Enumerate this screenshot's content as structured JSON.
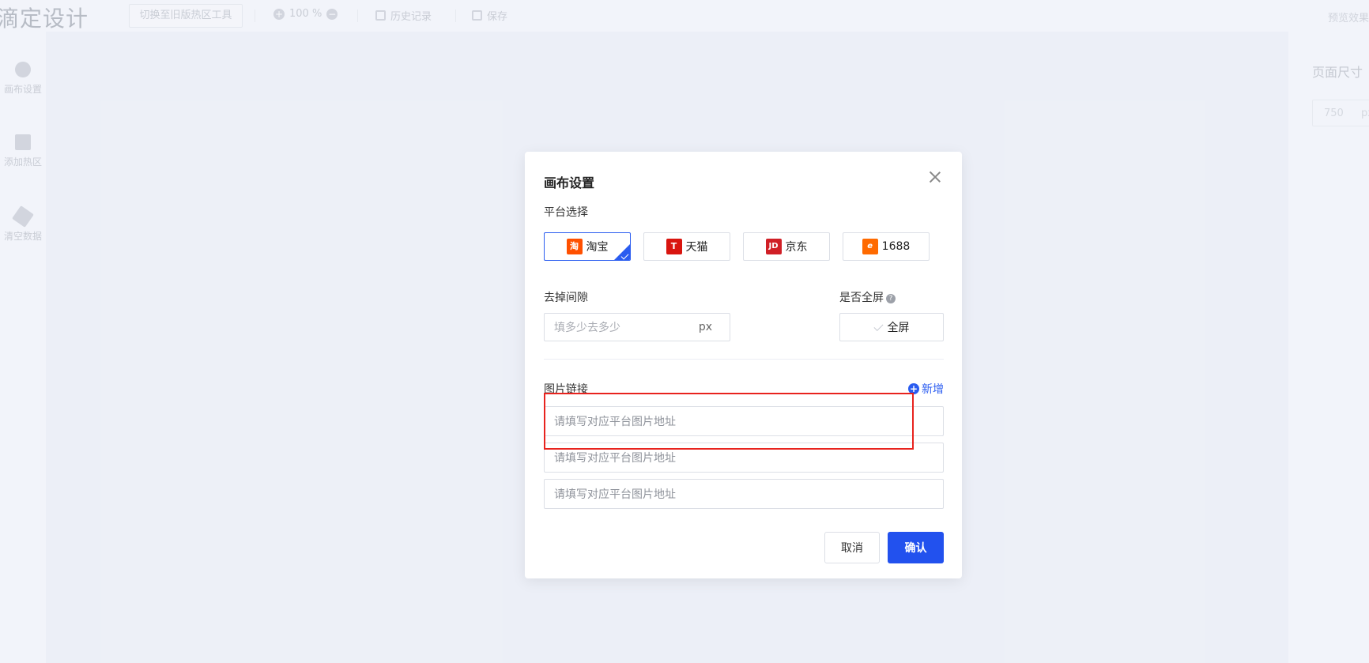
{
  "app": {
    "logo": "滴定设计",
    "switch_tool": "切换至旧版热区工具",
    "zoom": "100 %",
    "history": "历史记录",
    "save": "保存",
    "preview": "预览效果"
  },
  "left_sidebar": {
    "items": [
      {
        "label": "画布设置",
        "icon": "hexagon-icon"
      },
      {
        "label": "添加热区",
        "icon": "plus-square-icon"
      },
      {
        "label": "清空数据",
        "icon": "broom-icon"
      }
    ]
  },
  "right_panel": {
    "title": "页面尺寸",
    "width_value": "750",
    "unit": "px"
  },
  "modal": {
    "title": "画布设置",
    "platform_label": "平台选择",
    "platforms": [
      {
        "name": "淘宝",
        "icon_text": "淘",
        "color": "#ff5000",
        "selected": true
      },
      {
        "name": "天猫",
        "icon_text": "T",
        "color": "#d9150f",
        "selected": false
      },
      {
        "name": "京东",
        "icon_text": "JD",
        "color": "#d01f26",
        "selected": false
      },
      {
        "name": "1688",
        "icon_text": "e",
        "color": "#ff6a00",
        "selected": false
      }
    ],
    "gap_label": "去掉间隙",
    "gap_placeholder": "填多少去多少",
    "gap_unit": "px",
    "fullscreen_label": "是否全屏",
    "fullscreen_help": "?",
    "fullscreen_button": "全屏",
    "image_link_label": "图片链接",
    "add_label": "新增",
    "url_inputs": [
      {
        "placeholder": "请填写对应平台图片地址"
      },
      {
        "placeholder": "请填写对应平台图片地址"
      },
      {
        "placeholder": "请填写对应平台图片地址"
      }
    ],
    "cancel_label": "取消",
    "confirm_label": "确认"
  },
  "colors": {
    "accent": "#2251ee",
    "highlight": "#e8231e"
  }
}
